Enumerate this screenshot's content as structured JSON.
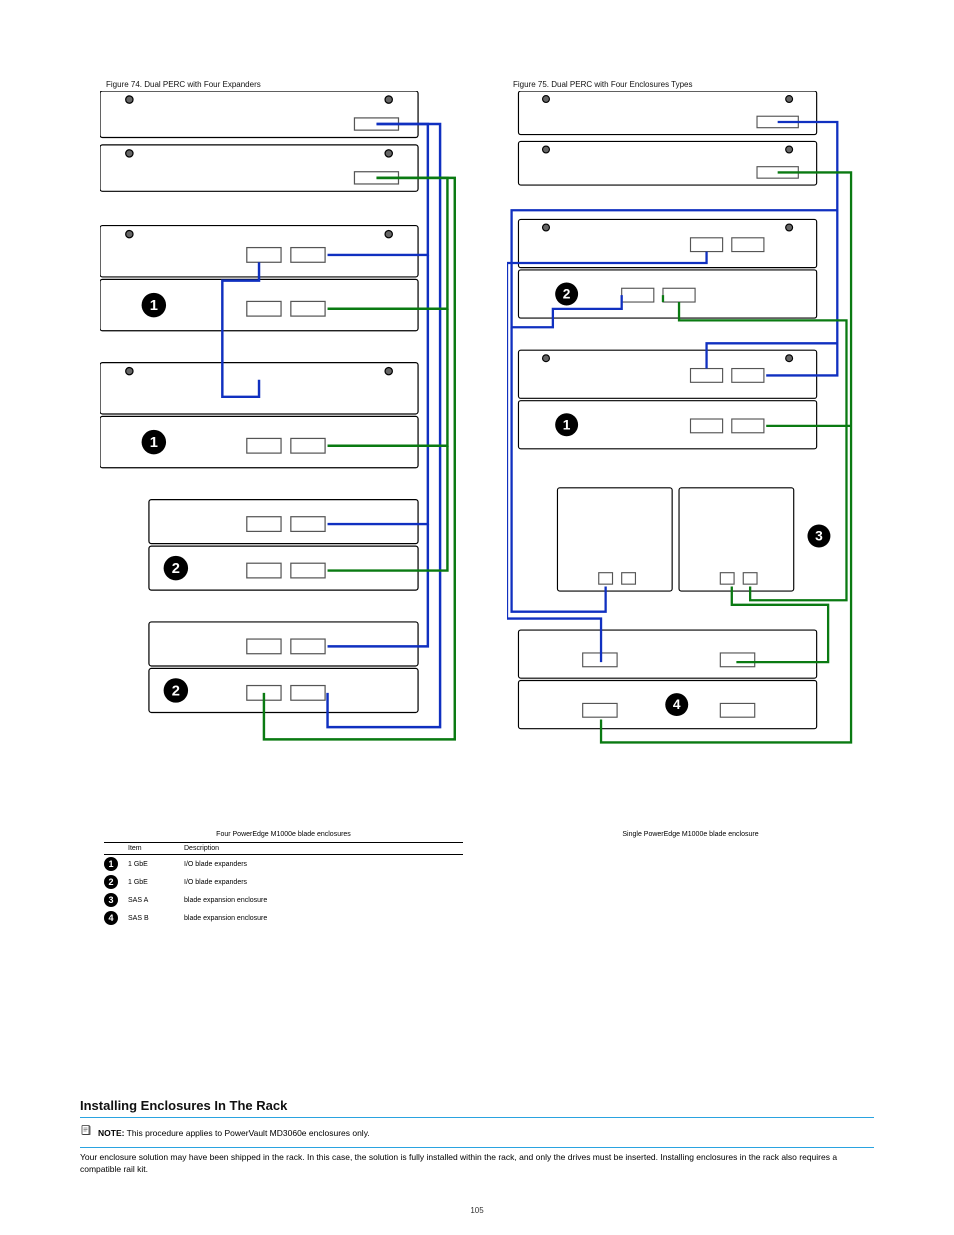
{
  "figureLeft": {
    "title": "Figure 74. Dual PERC with Four Expanders",
    "caption": "Four PowerEdge M1000e blade enclosures"
  },
  "figureRight": {
    "title": "Figure 75. Dual PERC with Four Enclosures Types",
    "caption": "Single PowerEdge M1000e blade enclosure"
  },
  "legendHeader": {
    "col1": "Item",
    "col2": "Description"
  },
  "legendRows": [
    {
      "num": "1",
      "item": "1 GbE",
      "desc": "I/O blade expanders"
    },
    {
      "num": "2",
      "item": "1 GbE",
      "desc": "I/O blade expanders"
    },
    {
      "num": "3",
      "item": "SAS A",
      "desc": "blade expansion enclosure"
    },
    {
      "num": "4",
      "item": "SAS B",
      "desc": "blade expansion enclosure"
    }
  ],
  "diagCallouts": {
    "left": [
      "1",
      "1",
      "2",
      "2"
    ],
    "right": [
      "2",
      "1",
      "3",
      "4"
    ]
  },
  "bottom": {
    "heading": "Installing Enclosures In The Rack",
    "noteLabel": "NOTE:",
    "noteText": "This procedure applies to PowerVault MD3060e enclosures only.",
    "text": "Your enclosure solution may have been shipped in the rack. In this case, the solution is fully installed within the rack, and only the drives must be inserted. Installing enclosures in the rack also requires a compatible rail kit."
  },
  "pageNumber": "105"
}
